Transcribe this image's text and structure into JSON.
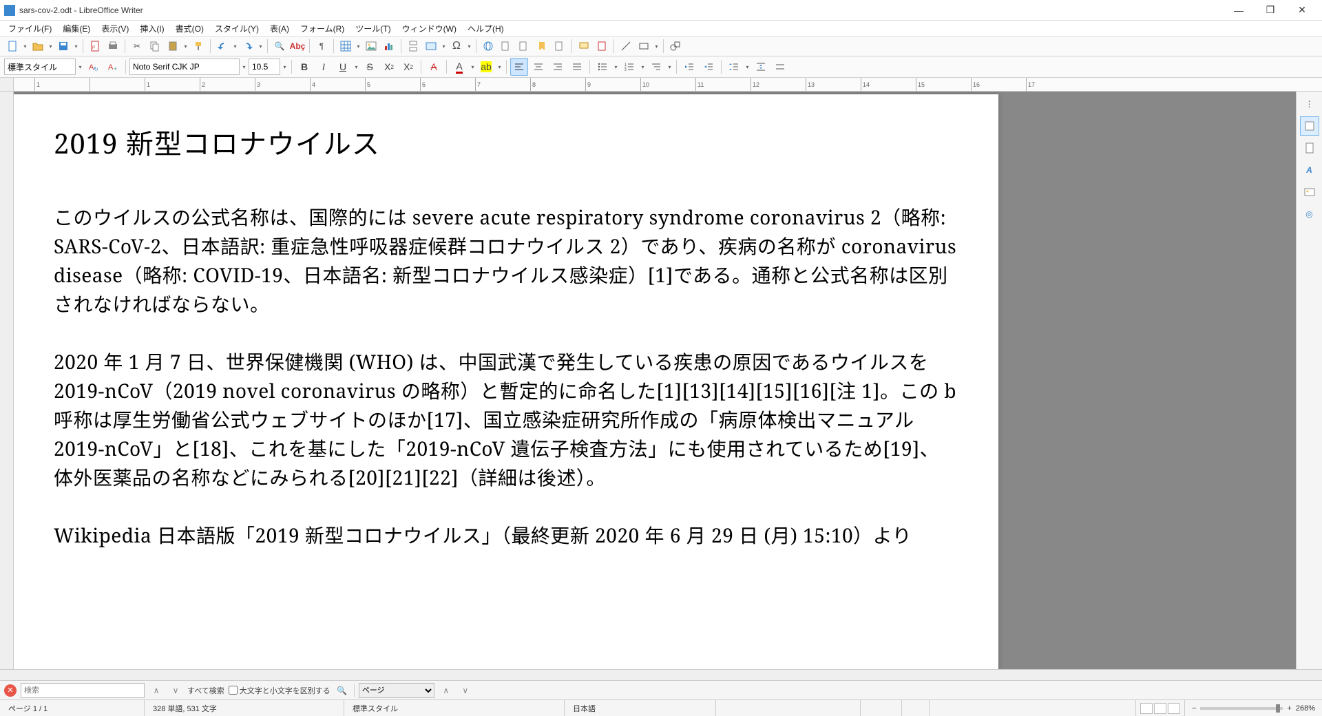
{
  "title": "sars-cov-2.odt - LibreOffice Writer",
  "menu": [
    "ファイル(F)",
    "編集(E)",
    "表示(V)",
    "挿入(I)",
    "書式(O)",
    "スタイル(Y)",
    "表(A)",
    "フォーム(R)",
    "ツール(T)",
    "ウィンドウ(W)",
    "ヘルプ(H)"
  ],
  "format": {
    "para_style": "標準スタイル",
    "font_name": "Noto Serif CJK JP",
    "font_size": "10.5"
  },
  "document": {
    "heading": "2019 新型コロナウイルス",
    "para1": "このウイルスの公式名称は、国際的には severe acute respiratory syndrome coronavirus 2（略称: SARS-CoV-2、日本語訳: 重症急性呼吸器症候群コロナウイルス 2）であり、疾病の名称が coronavirus disease（略称: COVID-19、日本語名: 新型コロナウイルス感染症）[1]である。通称と公式名称は区別されなければならない。",
    "para2": "2020 年 1 月 7 日、世界保健機関 (WHO) は、中国武漢で発生している疾患の原因であるウイルスを 2019-nCoV（2019 novel coronavirus の略称）と暫定的に命名した[1][13][14][15][16][注 1]。この b 呼称は厚生労働省公式ウェブサイトのほか[17]、国立感染症研究所作成の「病原体検出マニュアル 2019-nCoV」と[18]、これを基にした「2019-nCoV 遺伝子検査方法」にも使用されているため[19]、体外医薬品の名称などにみられる[20][21][22]（詳細は後述）。",
    "para3": "Wikipedia 日本語版「2019 新型コロナウイルス」（最終更新 2020 年 6 月 29 日 (月) 15:10）より"
  },
  "find": {
    "placeholder": "検索",
    "find_all": "すべて検索",
    "match_case": "大文字と小文字を区別する",
    "nav_select": "ページ"
  },
  "status": {
    "page": "ページ 1 / 1",
    "words": "328 単語, 531 文字",
    "style": "標準スタイル",
    "lang": "日本語",
    "zoom": "268%"
  },
  "ruler_ticks": [
    "1",
    "",
    "1",
    "2",
    "3",
    "4",
    "5",
    "6",
    "7",
    "8",
    "9",
    "10",
    "11",
    "12",
    "13",
    "14",
    "15",
    "16",
    "17"
  ]
}
